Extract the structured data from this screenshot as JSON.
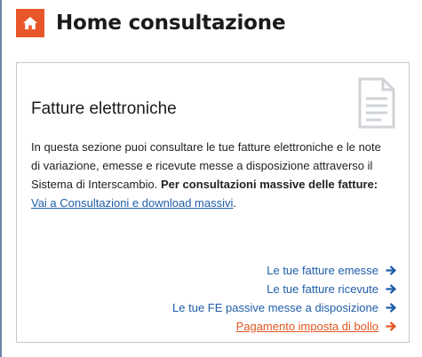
{
  "header": {
    "title": "Home consultazione",
    "home_icon": "home-icon",
    "home_color": "#e8572a"
  },
  "card": {
    "title": "Fatture elettroniche",
    "icon": "document-icon",
    "description": {
      "text": "In questa sezione puoi consultare le tue fatture elettroniche e le note di variazione, emesse e ricevute messe a disposizione attraverso il Sistema di Interscambio. ",
      "bold_text": "Per consultazioni massive delle fatture:",
      "link_text": "Vai a Consultazioni e download massivi",
      "trailing": "."
    },
    "links": [
      {
        "label": "Le tue fatture emesse",
        "color": "#1f5da8",
        "icon": "arrow-right-icon"
      },
      {
        "label": "Le tue fatture ricevute",
        "color": "#1f5da8",
        "icon": "arrow-right-icon"
      },
      {
        "label": "Le tue FE passive messe a disposizione",
        "color": "#1f5da8",
        "icon": "arrow-right-icon"
      },
      {
        "label": "Pagamento imposta di bollo",
        "color": "#e0571f",
        "icon": "arrow-right-icon"
      }
    ]
  }
}
